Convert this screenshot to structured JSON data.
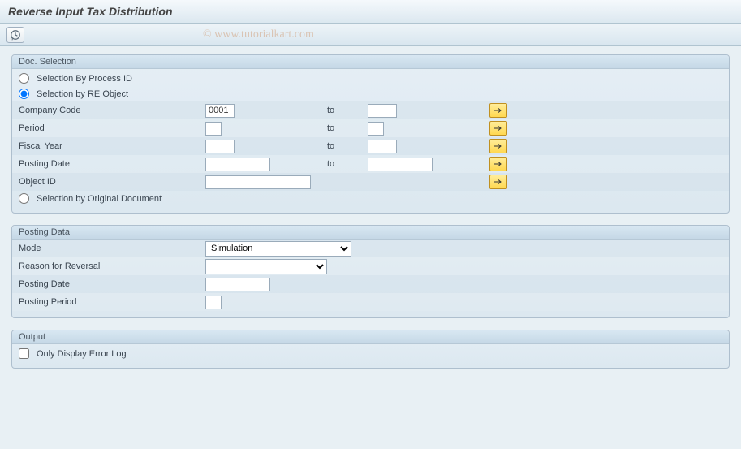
{
  "title": "Reverse Input Tax Distribution",
  "watermark": "© www.tutorialkart.com",
  "docSelection": {
    "header": "Doc. Selection",
    "radioProcess": "Selection By Process ID",
    "radioRE": "Selection by RE Object",
    "radioOriginal": "Selection by Original Document",
    "companyCode": {
      "label": "Company Code",
      "from": "0001",
      "to": ""
    },
    "period": {
      "label": "Period",
      "from": "",
      "to": ""
    },
    "fiscalYear": {
      "label": "Fiscal Year",
      "from": "",
      "to": ""
    },
    "postingDate": {
      "label": "Posting Date",
      "from": "",
      "to": ""
    },
    "objectId": {
      "label": "Object ID",
      "from": ""
    },
    "toLabel": "to"
  },
  "postingData": {
    "header": "Posting Data",
    "mode": {
      "label": "Mode",
      "value": "Simulation"
    },
    "reason": {
      "label": "Reason for Reversal",
      "value": ""
    },
    "postingDate": {
      "label": "Posting Date",
      "value": ""
    },
    "postingPeriod": {
      "label": "Posting Period",
      "value": ""
    }
  },
  "output": {
    "header": "Output",
    "errorLog": "Only Display Error Log"
  }
}
